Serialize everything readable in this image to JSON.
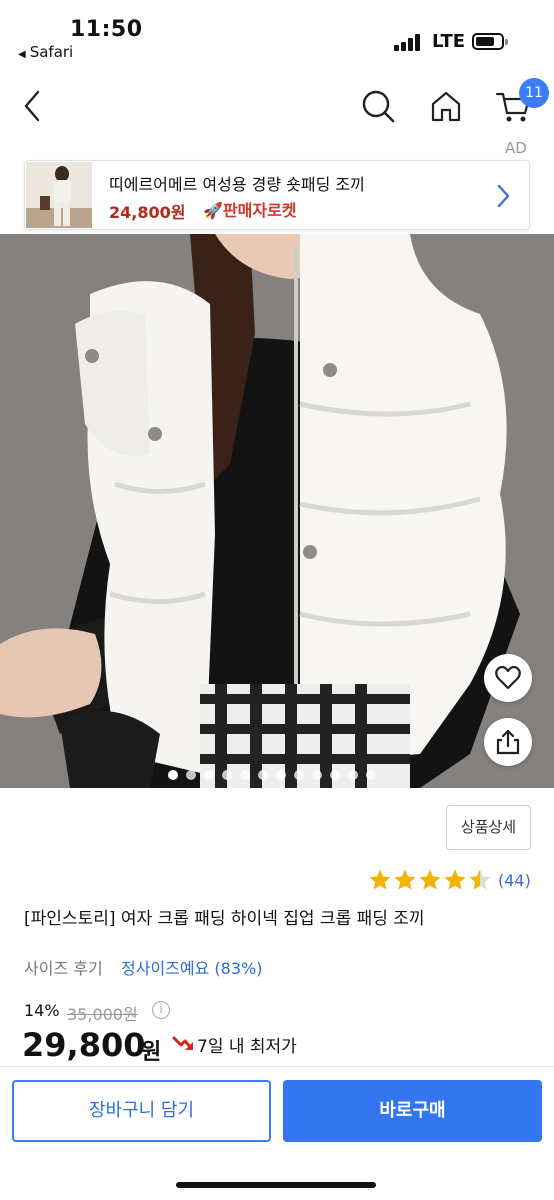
{
  "status_bar": {
    "time": "11:50",
    "back_app": "Safari",
    "network": "LTE"
  },
  "nav": {
    "back_icon": "chevron-left-icon",
    "search_icon": "search-icon",
    "home_icon": "home-icon",
    "cart_icon": "cart-icon",
    "cart_badge": "11"
  },
  "ad": {
    "label": "AD",
    "title": "띠에르어메르 여성용 경량 숏패딩 조끼",
    "price": "24,800원",
    "delivery": "🚀판매자로켓"
  },
  "gallery": {
    "total": 12,
    "active_index": 0,
    "like_icon": "heart-icon",
    "share_icon": "share-icon"
  },
  "product": {
    "detail_button": "상품상세",
    "rating": 4.5,
    "rating_count": "(44)",
    "title": "[파인스토리] 여자 크롭 패딩 하이넥 집업 크롭 패딩 조끼",
    "review_label": "사이즈 후기",
    "review_value": "정사이즈예요 (83%)",
    "discount": "14%",
    "original_price": "35,000원",
    "info_icon": "i",
    "price": "29,800",
    "price_unit": "원",
    "lowest_label": "7일 내 최저가"
  },
  "bottom_bar": {
    "add_to_cart": "장바구니 담기",
    "buy_now": "바로구매"
  },
  "colors": {
    "accent": "#3476f0",
    "rocket": "#d1362b",
    "star": "#f5b301"
  }
}
